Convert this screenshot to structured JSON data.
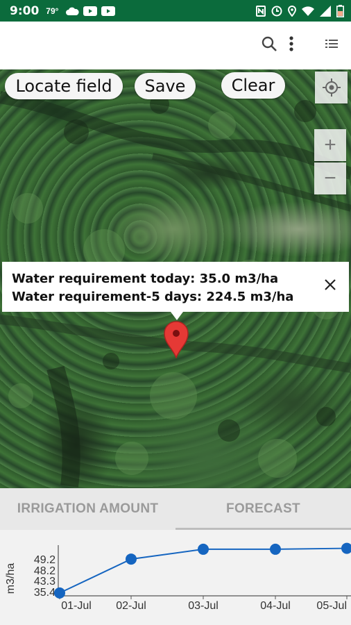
{
  "status_bar": {
    "time": "9:00",
    "temperature": "79°",
    "left_icons": [
      "cloud-icon",
      "youtube-icon",
      "youtube-icon"
    ],
    "right_icons": [
      "nfc-icon",
      "sync-icon",
      "location-icon",
      "wifi-icon",
      "signal-icon",
      "battery-icon"
    ]
  },
  "app_bar": {
    "actions": [
      "search-icon",
      "more-vert-icon",
      "list-icon"
    ]
  },
  "map": {
    "buttons": {
      "locate_field": "Locate field",
      "save": "Save",
      "clear": "Clear"
    },
    "controls": {
      "zoom_in": "+",
      "zoom_out": "−"
    },
    "info_window": {
      "line1": "Water requirement today: 35.0 m3/ha",
      "line2": "Water requirement-5 days: 224.5 m3/ha"
    },
    "marker_color": "#e53935"
  },
  "tabs": [
    {
      "label": "IRRIGATION AMOUNT",
      "active": false
    },
    {
      "label": "FORECAST",
      "active": true
    }
  ],
  "chart_data": {
    "type": "line",
    "categories": [
      "01-Jul",
      "02-Jul",
      "03-Jul",
      "04-Jul",
      "05-Jul"
    ],
    "series": [
      {
        "values": [
          35.4,
          46.1,
          49.2,
          49.2,
          49.5
        ],
        "color": "#1565c0"
      }
    ],
    "ylabel": "m3/ha",
    "ytick_labels": [
      "49.2",
      "48.2",
      "43.3",
      "35.4"
    ],
    "grid": false
  }
}
